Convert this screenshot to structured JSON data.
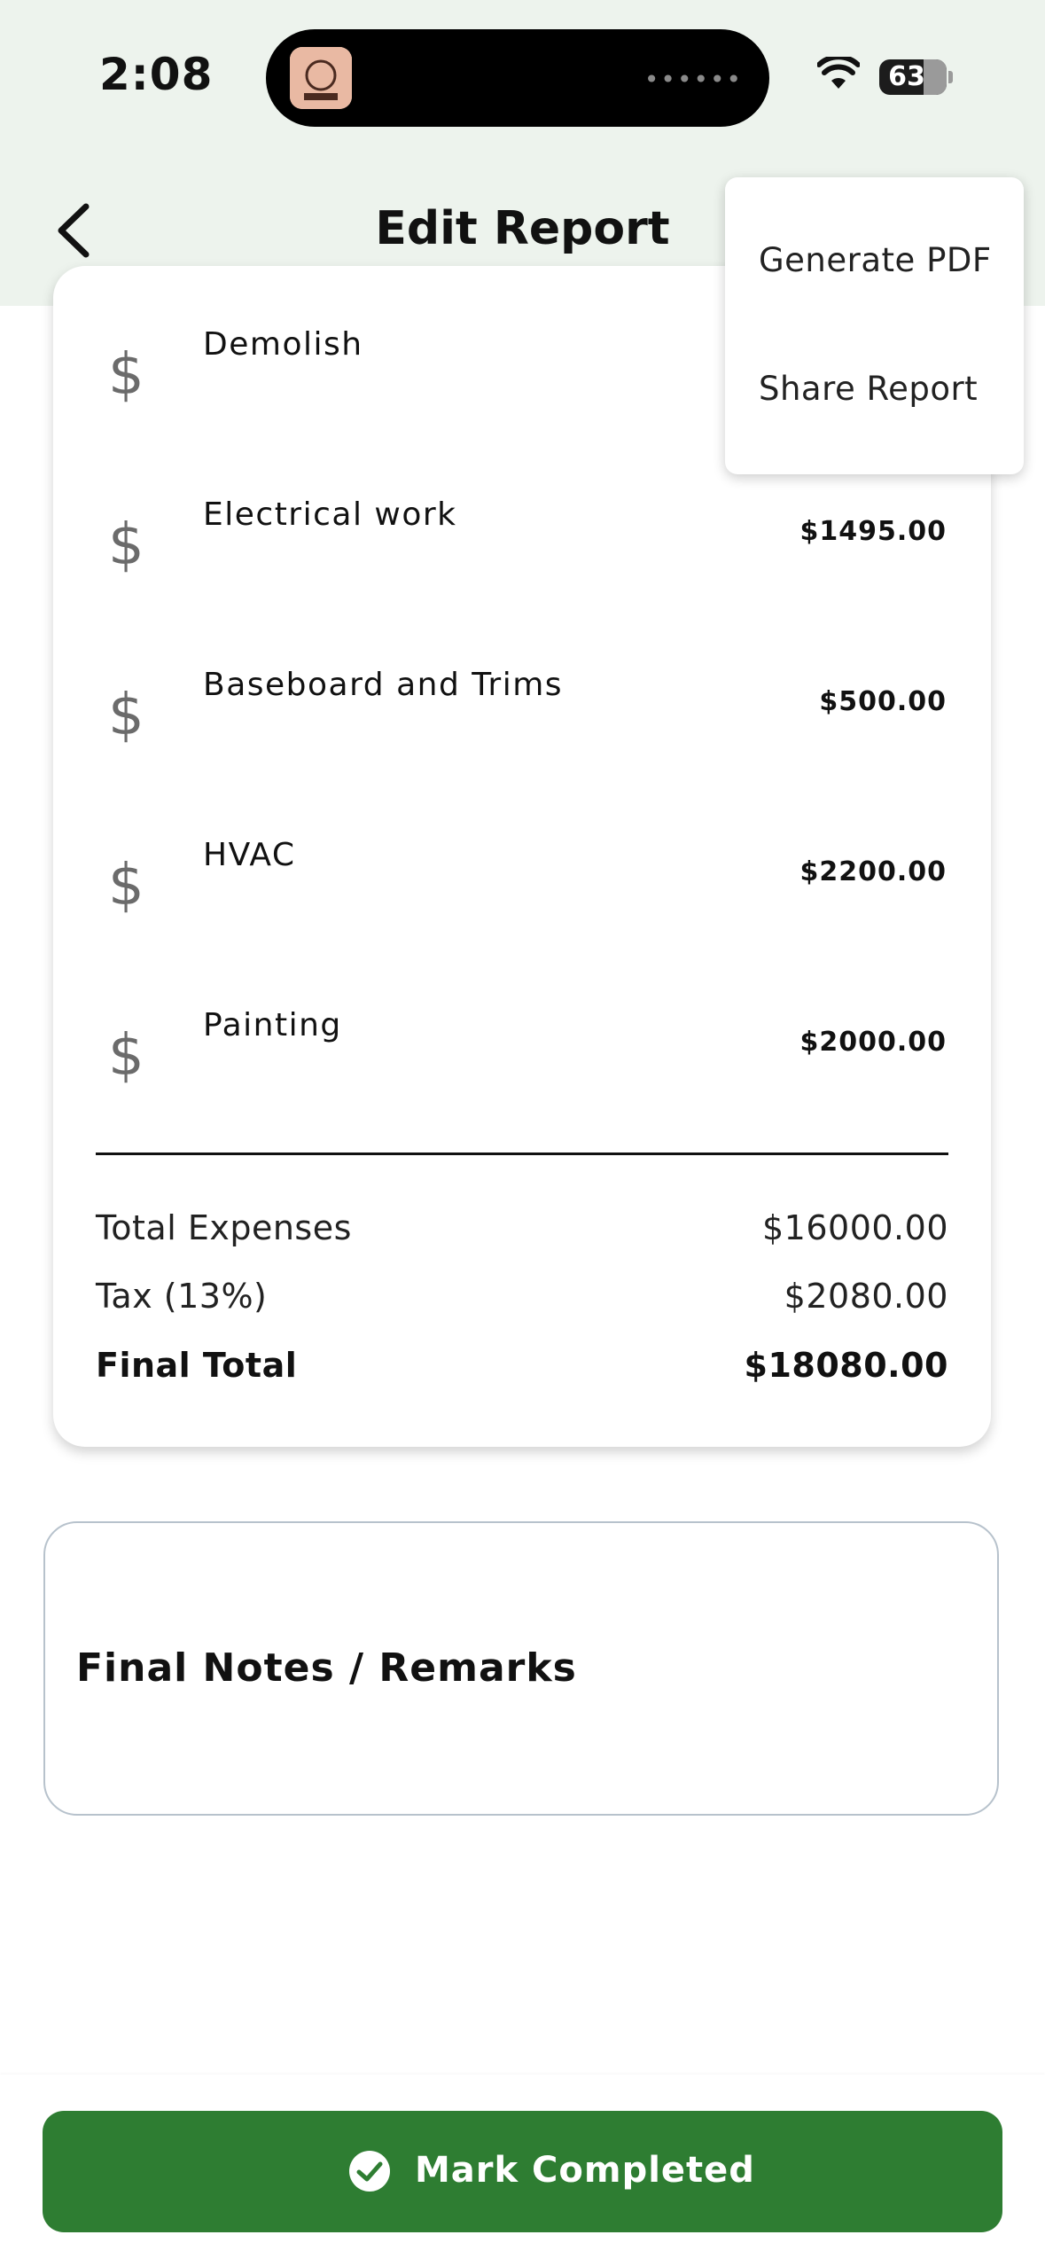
{
  "status_bar": {
    "time": "2:08",
    "battery": "63"
  },
  "header": {
    "title": "Edit Report"
  },
  "menu": {
    "items": [
      "Generate PDF",
      "Share Report"
    ]
  },
  "expenses": [
    {
      "name": "Demolish",
      "amount": ""
    },
    {
      "name": "Electrical work",
      "amount": "$1495.00"
    },
    {
      "name": "Baseboard and Trims",
      "amount": "$500.00"
    },
    {
      "name": "HVAC",
      "amount": "$2200.00"
    },
    {
      "name": "Painting",
      "amount": "$2000.00"
    }
  ],
  "dollar_symbol": "$",
  "summary": {
    "total_label": "Total Expenses",
    "total_value": "$16000.00",
    "tax_label": "Tax (13%)",
    "tax_value": "$2080.00",
    "final_label": "Final Total",
    "final_value": "$18080.00"
  },
  "notes": {
    "label": "Final Notes / Remarks"
  },
  "footer": {
    "button_label": "Mark Completed"
  },
  "colors": {
    "header_bg": "#edf3ed",
    "accent": "#2e7d32"
  }
}
